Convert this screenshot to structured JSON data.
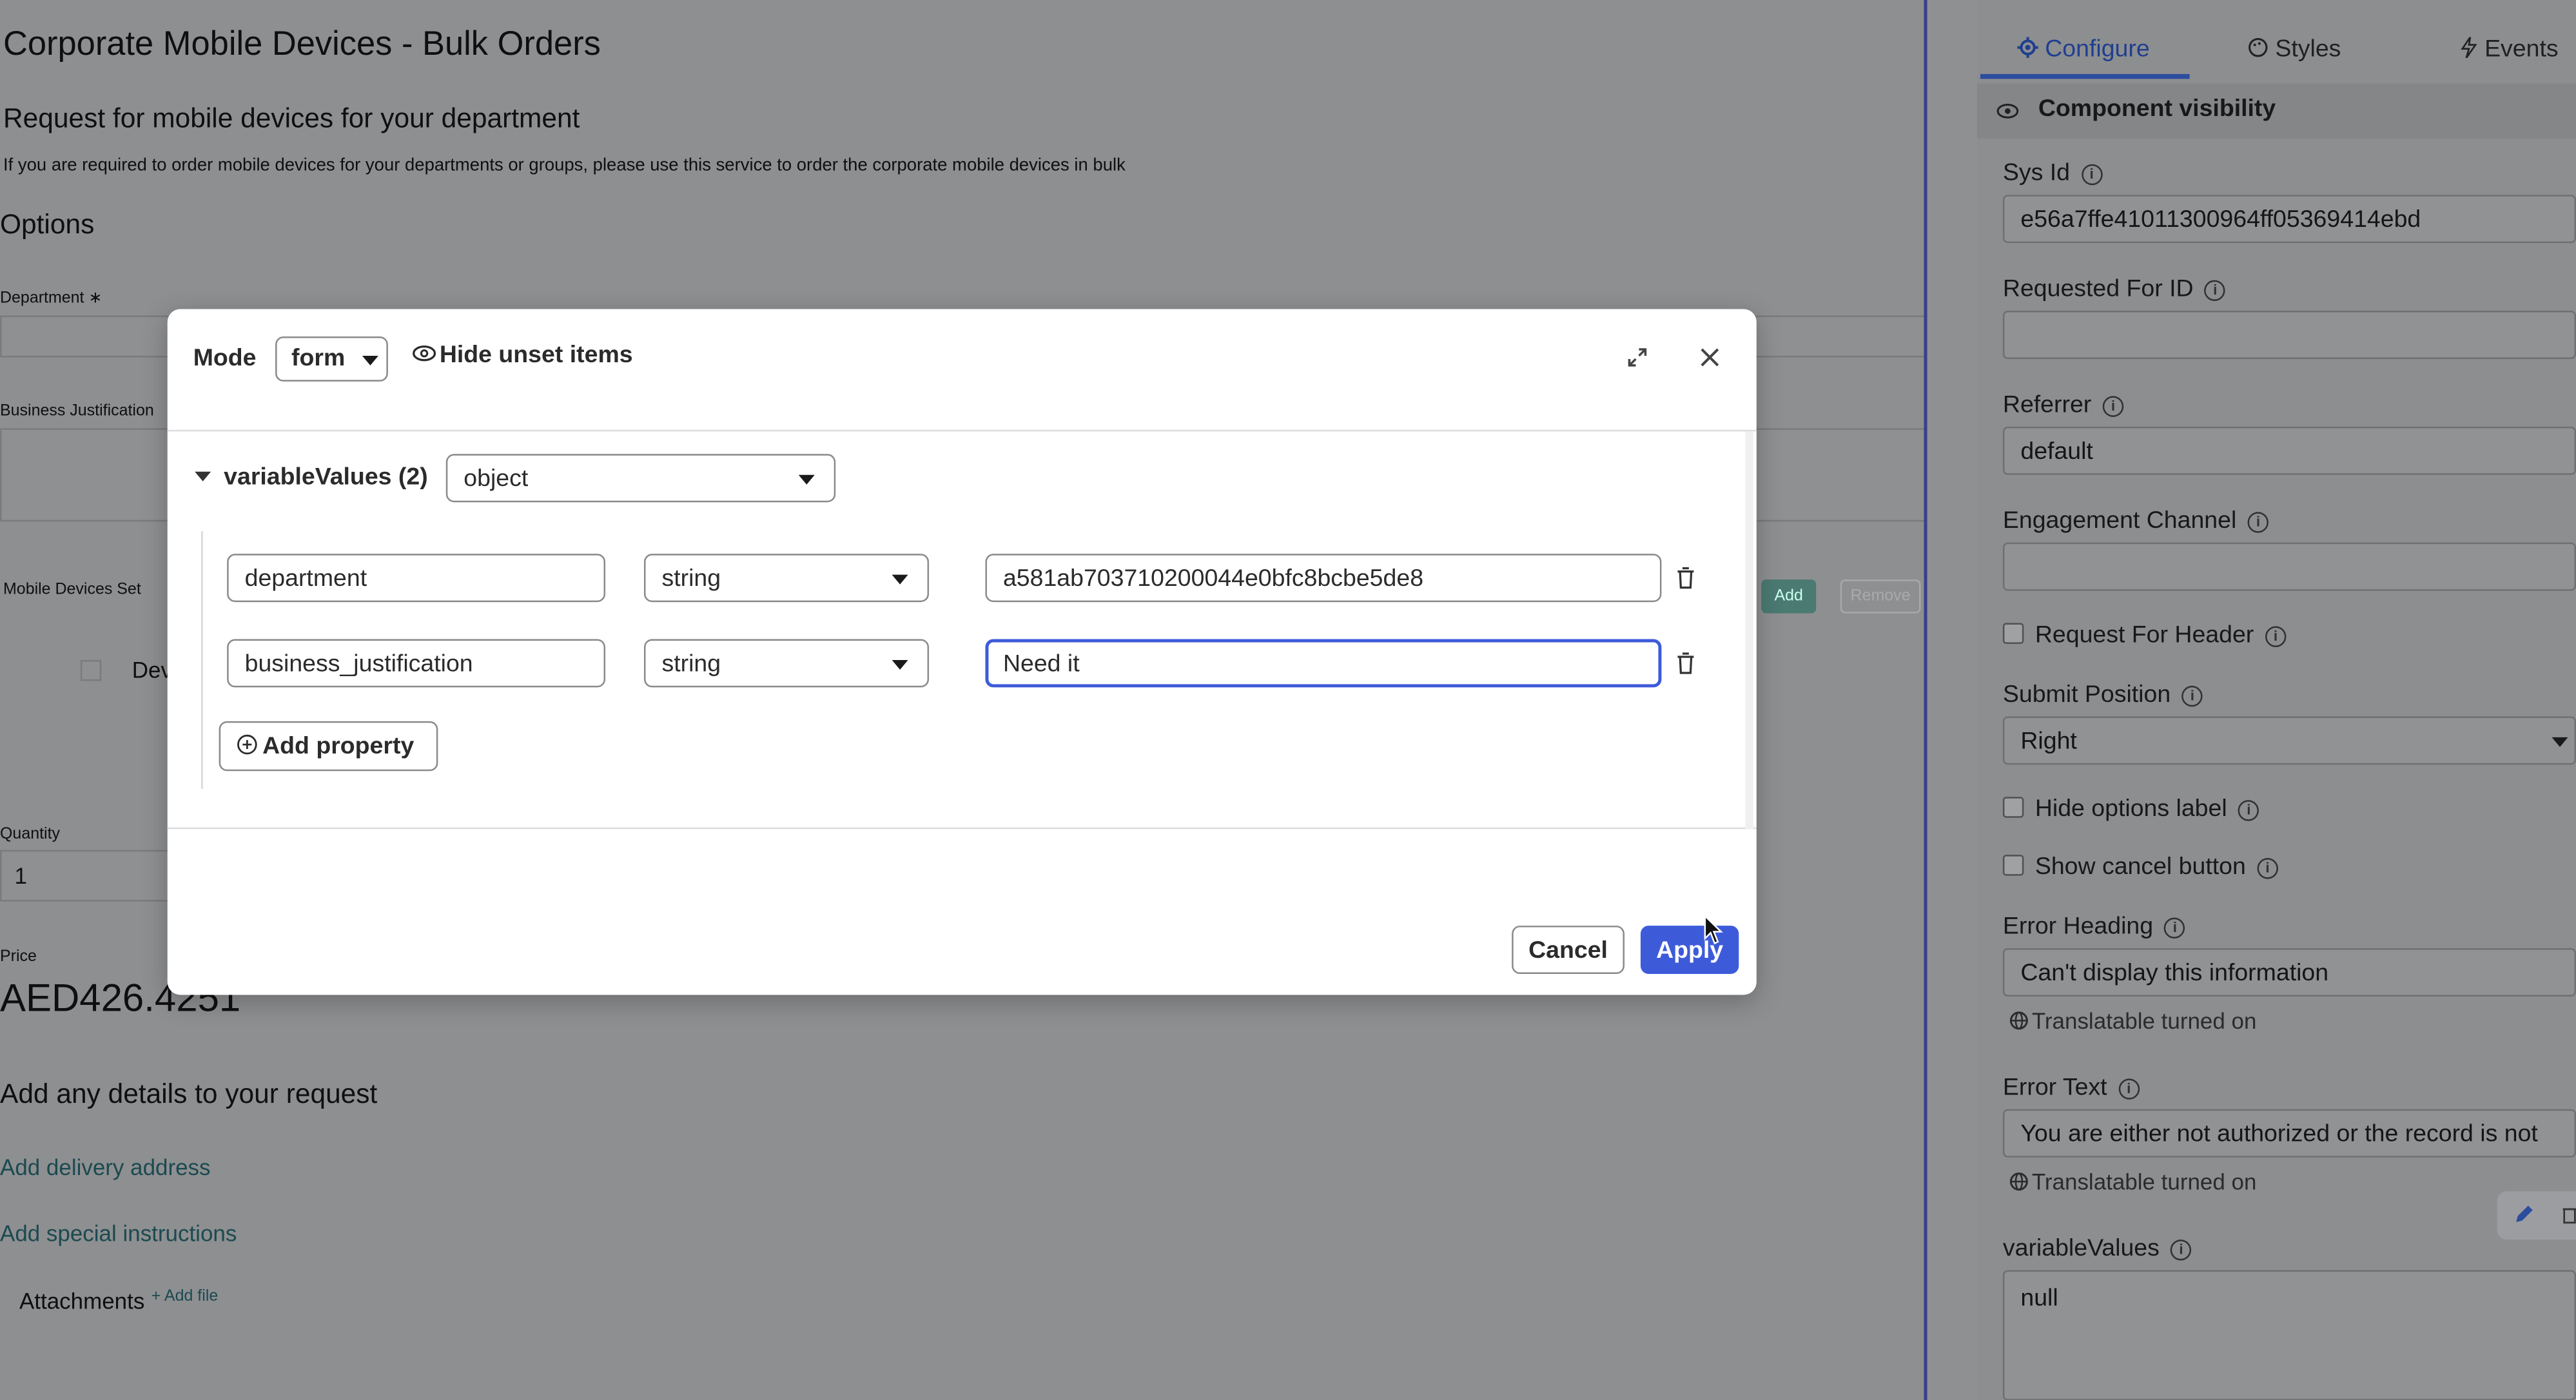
{
  "background_form": {
    "title": "Corporate Mobile Devices - Bulk Orders",
    "subtitle": "Request for mobile devices for your department",
    "description": "If you are required to order mobile devices for your departments or groups, please use this service to order the corporate mobile devices in bulk",
    "options_heading": "Options",
    "department_label": "Department",
    "required_mark": "∗",
    "business_justification_label": "Business Justification",
    "mobile_devices_set_label": "Mobile Devices Set",
    "add_button": "Add",
    "remove_button": "Remove",
    "row_text_partial": "Dev",
    "quantity_label": "Quantity",
    "quantity_value": "1",
    "price_label": "Price",
    "price_value": "AED426.4251",
    "details_heading": "Add any details to your request",
    "delivery_link": "Add delivery address",
    "special_link": "Add special instructions",
    "attachments_label": "Attachments",
    "add_file_link": "+ Add file"
  },
  "modal": {
    "mode_label": "Mode",
    "mode_value": "form",
    "hide_unset": "Hide unset items",
    "variable_values_label": "variableValues (2)",
    "variable_values_type": "object",
    "properties": [
      {
        "key": "department",
        "type": "string",
        "value": "a581ab703710200044e0bfc8bcbe5de8"
      },
      {
        "key": "business_justification",
        "type": "string",
        "value": "Need it"
      }
    ],
    "add_property": "Add property",
    "cancel": "Cancel",
    "apply": "Apply"
  },
  "panel": {
    "tabs": [
      "Configure",
      "Styles",
      "Events"
    ],
    "section": "Component visibility",
    "sys_id_label": "Sys Id",
    "sys_id_value": "e56a7ffe41011300964ff05369414ebd",
    "requested_for_label": "Requested For ID",
    "requested_for_value": "",
    "referrer_label": "Referrer",
    "referrer_value": "default",
    "engagement_label": "Engagement Channel",
    "engagement_value": "",
    "request_for_header": "Request For Header",
    "submit_position_label": "Submit Position",
    "submit_position_value": "Right",
    "hide_options_label": "Hide options label",
    "show_cancel_button": "Show cancel button",
    "error_heading_label": "Error Heading",
    "error_heading_value": "Can't display this information",
    "translatable": "Translatable turned on",
    "error_text_label": "Error Text",
    "error_text_value": "You are either not authorized or the record is not",
    "variable_values_label": "variableValues",
    "variable_values_value": "null"
  },
  "colors": {
    "accent": "#3d5bd9",
    "overlay_bg": "#8f9092",
    "tab_active": "#1f3f8f"
  }
}
